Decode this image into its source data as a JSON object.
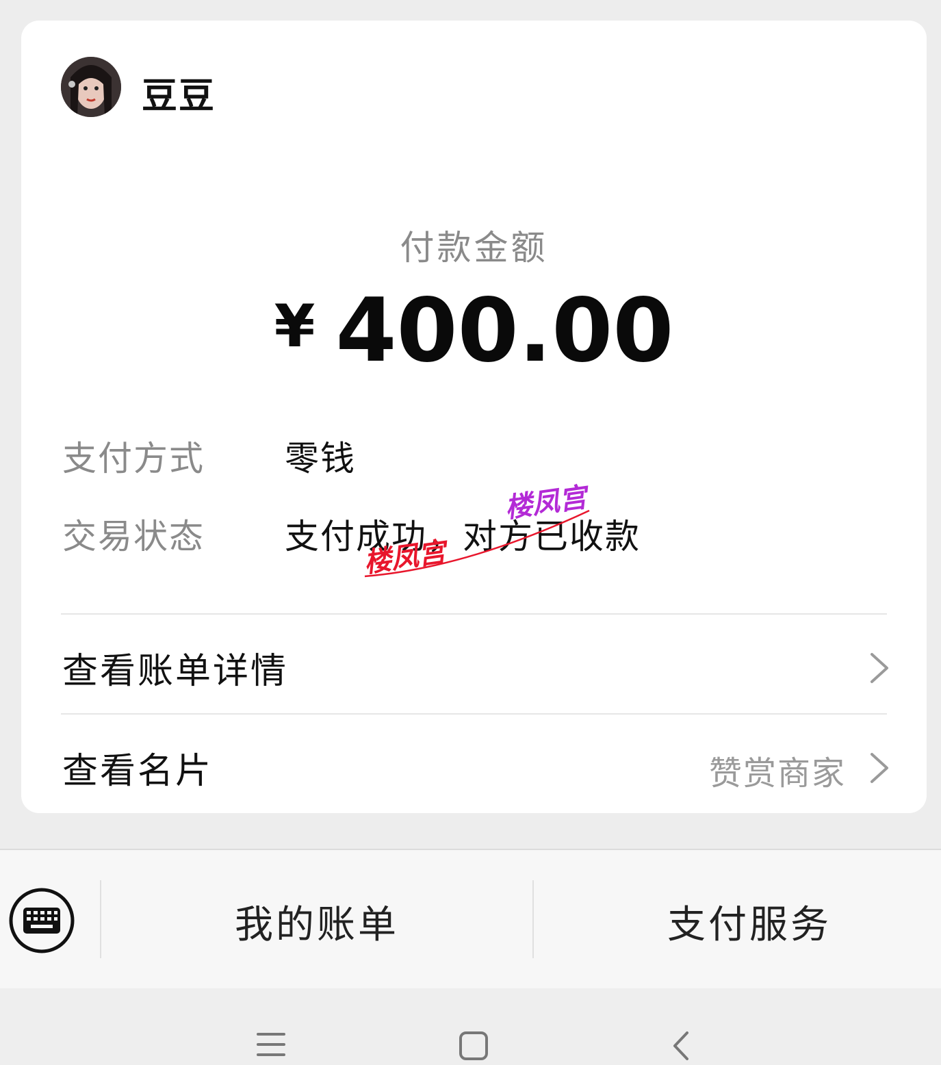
{
  "payee": {
    "name": "豆豆",
    "avatar_icon": "user-avatar-photo"
  },
  "amount": {
    "label": "付款金额",
    "currency": "¥",
    "value": "400.00"
  },
  "details": [
    {
      "key": "支付方式",
      "value": "零钱"
    },
    {
      "key": "交易状态",
      "value": "支付成功，对方已收款"
    }
  ],
  "menu": {
    "bill_detail": {
      "label": "查看账单详情"
    },
    "business_card": {
      "label": "查看名片",
      "sub": "赞赏商家"
    }
  },
  "watermarks": [
    "楼凤宫",
    "楼凤宫"
  ],
  "bottom_bar": {
    "keyboard_icon": "keyboard-icon",
    "my_bills": "我的账单",
    "pay_service": "支付服务"
  },
  "nav": {
    "menu_icon": "menu-icon",
    "home_icon": "home-icon",
    "back_icon": "back-icon"
  }
}
